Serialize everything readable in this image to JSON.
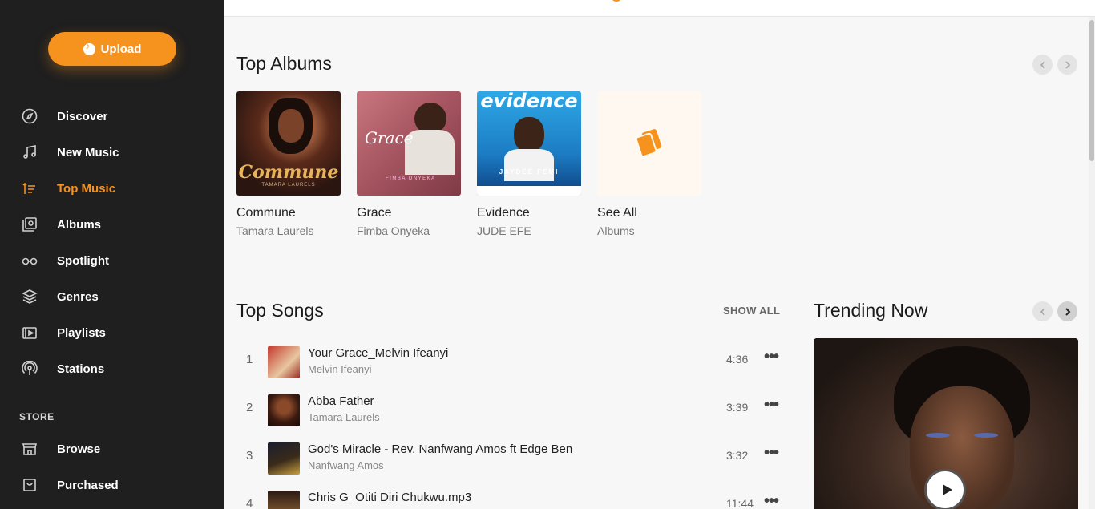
{
  "sidebar": {
    "upload_label": "Upload",
    "nav": [
      {
        "label": "Discover",
        "icon": "compass-icon"
      },
      {
        "label": "New Music",
        "icon": "music-note-icon"
      },
      {
        "label": "Top Music",
        "icon": "trending-list-icon",
        "active": true
      },
      {
        "label": "Albums",
        "icon": "album-icon"
      },
      {
        "label": "Spotlight",
        "icon": "glasses-icon"
      },
      {
        "label": "Genres",
        "icon": "layers-icon"
      },
      {
        "label": "Playlists",
        "icon": "playlist-icon"
      },
      {
        "label": "Stations",
        "icon": "radio-tower-icon"
      }
    ],
    "store_label": "STORE",
    "store_nav": [
      {
        "label": "Browse",
        "icon": "store-icon"
      },
      {
        "label": "Purchased",
        "icon": "bag-icon"
      }
    ]
  },
  "top_albums": {
    "heading": "Top Albums",
    "albums": [
      {
        "title": "Commune",
        "artist": "Tamara Laurels",
        "cover_text": "Commune",
        "cover_sub": "TAMARA LAURELS"
      },
      {
        "title": "Grace",
        "artist": "Fimba Onyeka",
        "cover_text": "Grace",
        "cover_sub": "FIMBA ONYEKA"
      },
      {
        "title": "Evidence",
        "artist": "JUDE EFE",
        "cover_text": "evidence",
        "cover_sub": "JAYDEE FEMI"
      },
      {
        "title": "See All",
        "artist": "Albums"
      }
    ]
  },
  "top_songs": {
    "heading": "Top Songs",
    "show_all": "SHOW ALL",
    "songs": [
      {
        "num": "1",
        "title": "Your Grace_Melvin Ifeanyi",
        "artist": "Melvin Ifeanyi",
        "duration": "4:36"
      },
      {
        "num": "2",
        "title": "Abba Father",
        "artist": "Tamara Laurels",
        "duration": "3:39"
      },
      {
        "num": "3",
        "title": "God's Miracle - Rev. Nanfwang Amos ft Edge Ben",
        "artist": "Nanfwang Amos",
        "duration": "3:32"
      },
      {
        "num": "4",
        "title": "Chris G_Otiti Diri Chukwu.mp3",
        "artist": "",
        "duration": "11:44"
      }
    ]
  },
  "trending": {
    "heading": "Trending Now"
  },
  "colors": {
    "accent": "#f6921e",
    "sidebar_bg": "#1f1f1f",
    "content_bg": "#f7f7f7"
  }
}
